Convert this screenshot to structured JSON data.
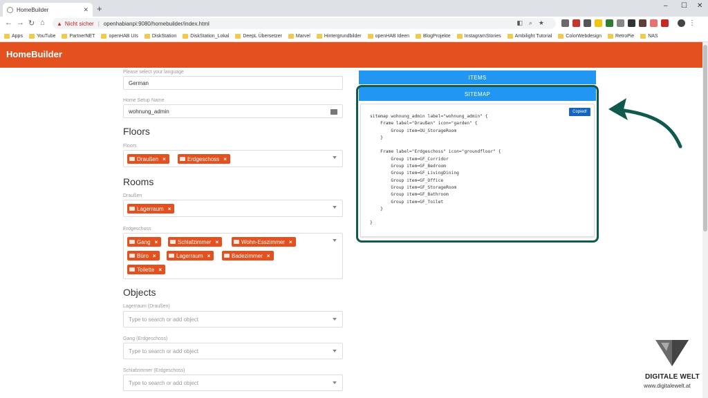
{
  "browser": {
    "tab_title": "HomeBuilder",
    "new_tab": "+",
    "url_warning": "Nicht sicher",
    "url": "openhabianpi:9080/homebuilder/index.html",
    "bookmarks": [
      "Apps",
      "YouTube",
      "PartnerNET",
      "openHAB UIs",
      "DiskStation",
      "DiskStation_Lokal",
      "DeepL Übersetzer",
      "Marvel",
      "Hintergrundbilder",
      "openHAB Ideen",
      "BlogProjekte",
      "InstagramStories",
      "Ambilight Tutorial",
      "ColorWebdesign",
      "RetroPie",
      "NAS"
    ]
  },
  "app": {
    "title": "HomeBuilder",
    "accent": "#e4501e",
    "blue": "#2196f3"
  },
  "form": {
    "language_label": "Please select your language",
    "language_value": "German",
    "setup_name_label": "Home Setup Name",
    "setup_name_value": "wohnung_admin",
    "floors_heading": "Floors",
    "floors_label": "Floors",
    "floors": [
      "Draußen",
      "Erdgeschoss"
    ],
    "rooms_heading": "Rooms",
    "rooms_outdoor_label": "Draußen",
    "rooms_outdoor": [
      "Lagerraum"
    ],
    "rooms_ground_label": "Erdgeschoss",
    "rooms_ground": [
      "Gang",
      "Schlafzimmer",
      "Wohn-Esszimmer",
      "Büro",
      "Lagerraum",
      "Badezimmer",
      "Toilette"
    ],
    "objects_heading": "Objects",
    "objects": [
      {
        "label": "Lagerraum (Draußen)",
        "placeholder": "Type to search or add object"
      },
      {
        "label": "Gang (Erdgeschoss)",
        "placeholder": "Type to search or add object"
      },
      {
        "label": "Schlafzimmer (Erdgeschoss)",
        "placeholder": "Type to search or add object"
      }
    ]
  },
  "panel": {
    "items_button": "ITEMS",
    "sitemap_button": "SITEMAP",
    "copied_button": "Copied!",
    "code": "sitemap wohnung_admin label=\"wohnung_admin\" {\n    Frame label=\"Draußen\" icon=\"garden\" {\n        Group item=OU_StorageRoom\n    }\n\n    Frame label=\"Erdgeschoss\" icon=\"groundfloor\" {\n        Group item=GF_Corridor\n        Group item=GF_Bedroom\n        Group item=GF_LivingDining\n        Group item=GF_Office\n        Group item=GF_StorageRoom\n        Group item=GF_Bathroom\n        Group item=GF_Toilet\n    }\n\n}"
  },
  "watermark": {
    "brand": "DIGITALE WELT",
    "url": "www.digitalewelt.at"
  }
}
